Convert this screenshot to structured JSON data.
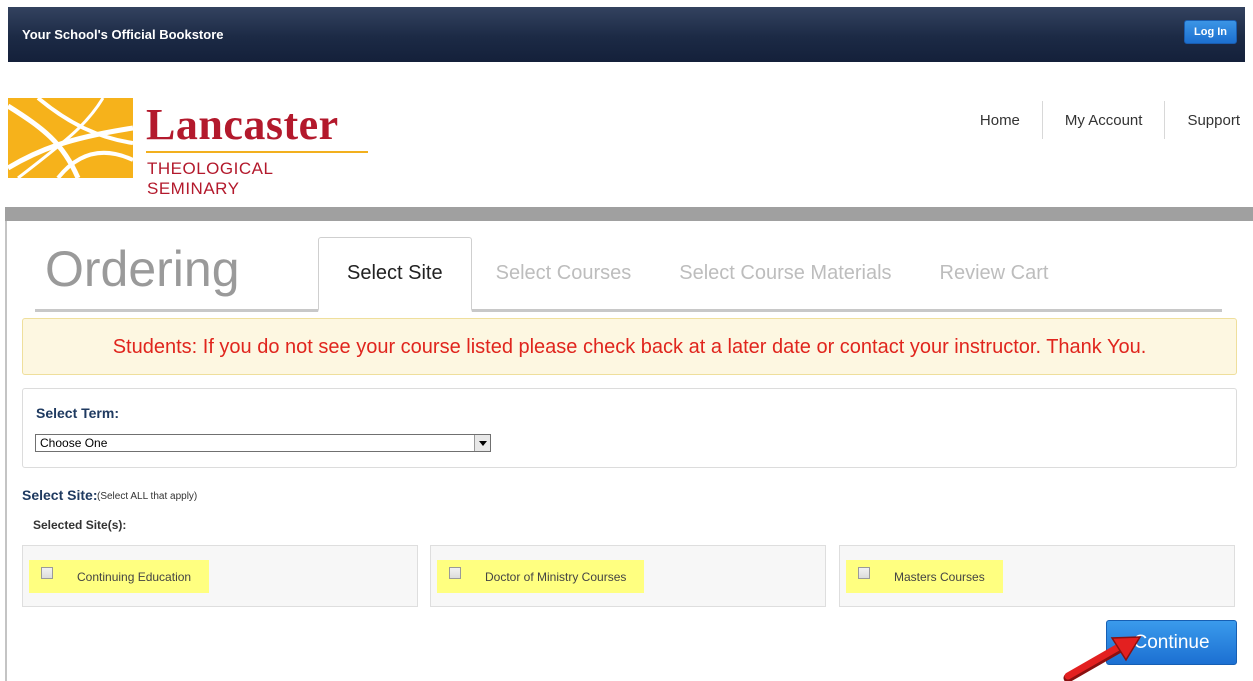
{
  "topbar": {
    "store_title": "Your School's Official Bookstore",
    "login_label": "Log In"
  },
  "logo": {
    "name": "Lancaster",
    "subtitle": "THEOLOGICAL SEMINARY"
  },
  "nav": [
    {
      "label": "Home"
    },
    {
      "label": "My Account"
    },
    {
      "label": "Support"
    }
  ],
  "ordering": {
    "title": "Ordering",
    "tabs": [
      {
        "label": "Select Site",
        "active": true
      },
      {
        "label": "Select Courses",
        "active": false
      },
      {
        "label": "Select Course Materials",
        "active": false
      },
      {
        "label": "Review Cart",
        "active": false
      }
    ]
  },
  "notice": "Students: If you do not see your course listed please check back at a later date or contact your instructor. Thank You.",
  "term": {
    "label": "Select Term:",
    "selected": "Choose One"
  },
  "site": {
    "label": "Select Site:",
    "note": "(Select ALL that apply)",
    "selected_label": "Selected Site(s):",
    "options": [
      {
        "label": "Continuing Education",
        "checked": false
      },
      {
        "label": "Doctor of Ministry Courses",
        "checked": false
      },
      {
        "label": "Masters Courses",
        "checked": false
      }
    ]
  },
  "continue_label": "Continue",
  "colors": {
    "brand_red": "#b3192c",
    "brand_gold": "#f2b01e",
    "navy": "#1c2a45",
    "button_blue": "#1c70d2",
    "notice_red": "#e0251d",
    "highlight": "#ffff80"
  }
}
